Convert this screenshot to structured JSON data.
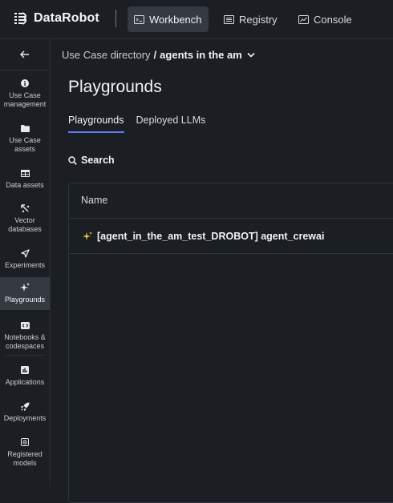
{
  "header": {
    "logo_text": "DataRobot",
    "nav": [
      {
        "label": "Workbench",
        "active": true
      },
      {
        "label": "Registry",
        "active": false
      },
      {
        "label": "Console",
        "active": false
      }
    ]
  },
  "sidebar": {
    "items": [
      {
        "label": "Use Case\nmanagement",
        "icon": "info-icon"
      },
      {
        "label": "Use Case\nassets",
        "icon": "folder-icon"
      },
      {
        "label": "Data assets",
        "icon": "table-icon"
      },
      {
        "label": "Vector\ndatabases",
        "icon": "vector-icon"
      },
      {
        "label": "Experiments",
        "icon": "experiment-icon"
      },
      {
        "label": "Playgrounds",
        "icon": "sparkles-icon",
        "active": true
      },
      {
        "label": "Notebooks &\ncodespaces",
        "icon": "code-icon"
      },
      {
        "label": "Applications",
        "icon": "app-icon"
      },
      {
        "label": "Deployments",
        "icon": "rocket-icon"
      },
      {
        "label": "Registered\nmodels",
        "icon": "models-icon"
      }
    ]
  },
  "breadcrumb": {
    "parent": "Use Case directory",
    "separator": "/",
    "current": "agents in the am"
  },
  "page": {
    "title": "Playgrounds",
    "tabs": [
      {
        "label": "Playgrounds",
        "active": true
      },
      {
        "label": "Deployed LLMs",
        "active": false
      }
    ],
    "search_label": "Search"
  },
  "table": {
    "columns": [
      "Name"
    ],
    "rows": [
      {
        "name": "[agent_in_the_am_test_DROBOT] agent_crewai"
      }
    ]
  },
  "colors": {
    "background": "#1b1e22",
    "active_item": "#353a41",
    "accent": "#5f7cf6",
    "sparkle": "#f2c94c"
  }
}
